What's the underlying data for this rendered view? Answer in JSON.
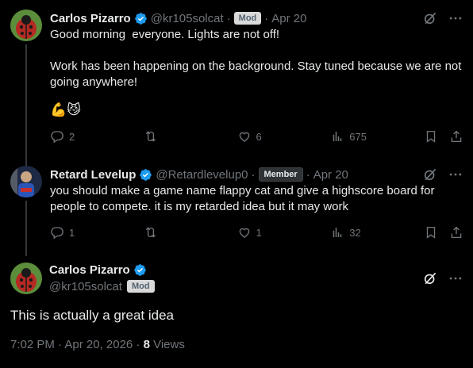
{
  "posts": [
    {
      "name": "Carlos Pizarro",
      "handle": "@kr105solcat",
      "badge": "Mod",
      "separator": "·",
      "date": "Apr 20",
      "text": "Good morning  everyone. Lights are not off!\n\nWork has been happening on the background. Stay tuned because we are not going anywhere!",
      "emoji": "💪😼",
      "replies": "2",
      "reposts": "",
      "likes": "6",
      "views": "675"
    },
    {
      "name": "Retard Levelup",
      "handle": "@Retardlevelup0",
      "badge": "Member",
      "separator": "·",
      "date": "Apr 20",
      "text": "you should make a game name flappy cat and give a highscore board for people to compete. it is my retarded idea but it may work",
      "replies": "1",
      "reposts": "",
      "likes": "1",
      "views": "32"
    }
  ],
  "main": {
    "name": "Carlos Pizarro",
    "handle": "@kr105solcat",
    "badge": "Mod",
    "text": "This is actually a great idea",
    "timestamp": "7:02 PM · Apr 20, 2026 · ",
    "views_count": "8",
    "views_label": " Views"
  },
  "icons": {
    "verified": "verified-badge-icon",
    "grok": "grok-icon",
    "more": "more-icon",
    "reply": "reply-icon",
    "repost": "repost-icon",
    "like": "heart-icon",
    "views": "views-icon",
    "bookmark": "bookmark-icon",
    "share": "share-icon"
  },
  "colors": {
    "background": "#000000",
    "text": "#e7e9ea",
    "muted": "#71767b",
    "verified": "#1d9bf0",
    "thread_line": "#333639"
  }
}
